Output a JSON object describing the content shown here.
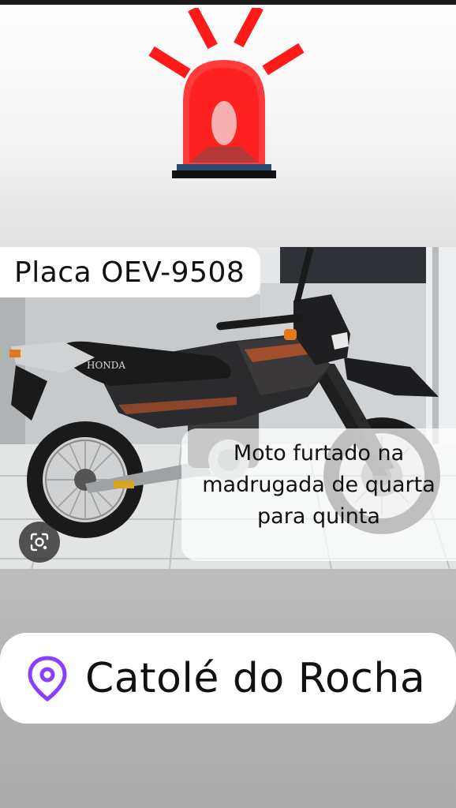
{
  "story": {
    "plate_label": "Placa OEV-9508",
    "caption_lines": [
      "Moto furtado na",
      "madrugada de quarta",
      "para quinta"
    ],
    "location": "Catolé do Rocha",
    "motorcycle_brand": "HONDA"
  },
  "icons": {
    "siren": "siren-icon",
    "location_pin": "location-pin-icon",
    "lens": "google-lens-icon"
  },
  "colors": {
    "siren_red": "#ff2a2a",
    "pin_purple": "#8a3ffc",
    "motorcycle_body": "#2b2b2e"
  }
}
